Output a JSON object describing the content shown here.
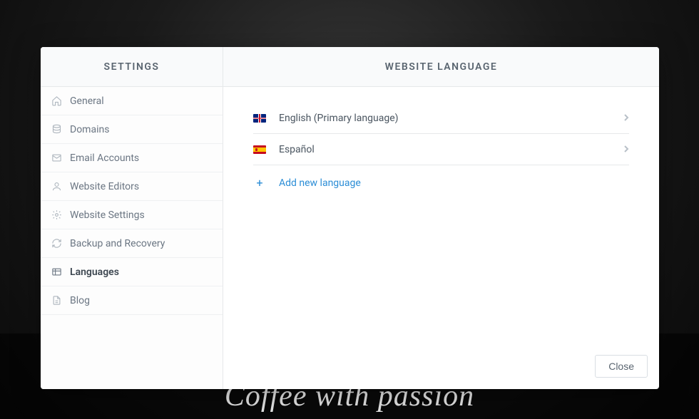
{
  "backdrop": {
    "tagline": "Coffee with passion"
  },
  "sidebar": {
    "title": "SETTINGS",
    "items": [
      {
        "label": "General",
        "icon": "home-icon"
      },
      {
        "label": "Domains",
        "icon": "database-icon"
      },
      {
        "label": "Email Accounts",
        "icon": "mail-icon"
      },
      {
        "label": "Website Editors",
        "icon": "user-icon"
      },
      {
        "label": "Website Settings",
        "icon": "gear-icon"
      },
      {
        "label": "Backup and Recovery",
        "icon": "refresh-icon"
      },
      {
        "label": "Languages",
        "icon": "globe-icon",
        "active": true
      },
      {
        "label": "Blog",
        "icon": "document-icon"
      }
    ]
  },
  "main": {
    "title": "WEBSITE LANGUAGE",
    "languages": [
      {
        "label": "English (Primary language)",
        "flag": "uk"
      },
      {
        "label": "Español",
        "flag": "es"
      }
    ],
    "add_label": "Add new language",
    "close_label": "Close"
  }
}
